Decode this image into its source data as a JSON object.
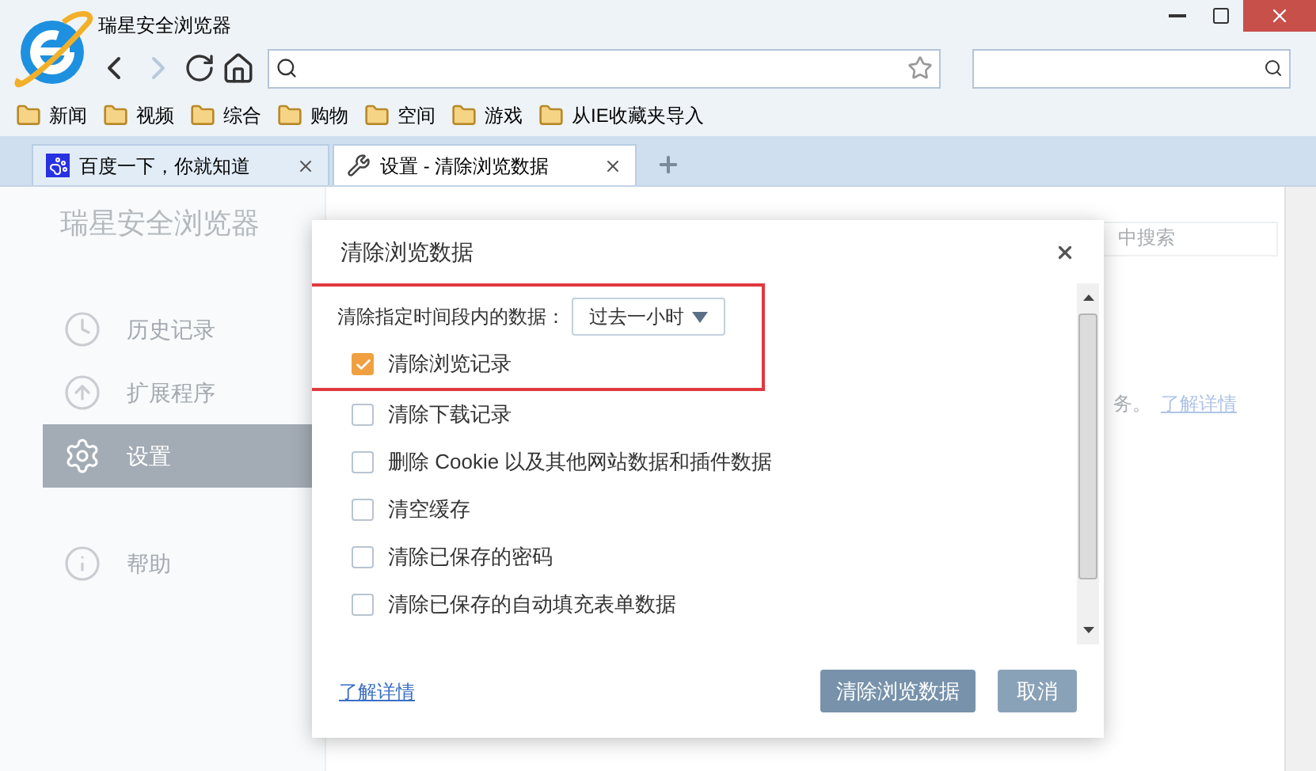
{
  "window": {
    "title": "瑞星安全浏览器"
  },
  "bookmarks": [
    {
      "label": "新闻"
    },
    {
      "label": "视频"
    },
    {
      "label": "综合"
    },
    {
      "label": "购物"
    },
    {
      "label": "空间"
    },
    {
      "label": "游戏"
    },
    {
      "label": "从IE收藏夹导入"
    }
  ],
  "tabs": [
    {
      "label": "百度一下，你就知道",
      "selected": false,
      "kind": "paw"
    },
    {
      "label": "设置 - 清除浏览数据",
      "selected": true,
      "kind": "wrench"
    }
  ],
  "sidebar": {
    "brand": "瑞星安全浏览器",
    "items": [
      {
        "label": "历史记录",
        "selected": false,
        "kind": "clock"
      },
      {
        "label": "扩展程序",
        "selected": false,
        "kind": "upload"
      },
      {
        "label": "设置",
        "selected": true,
        "kind": "gear"
      },
      {
        "label": "帮助",
        "selected": false,
        "kind": "info"
      }
    ]
  },
  "settings_page": {
    "search_placeholder": "中搜索",
    "text": "务。",
    "link": "了解详情"
  },
  "dialog": {
    "title": "清除浏览数据",
    "range_label": "清除指定时间段内的数据：",
    "range_value": "过去一小时",
    "options": [
      {
        "label": "清除浏览记录",
        "checked": true,
        "highlighted": true
      },
      {
        "label": "清除下载记录",
        "checked": false,
        "highlighted": false
      },
      {
        "label": "删除 Cookie 以及其他网站数据和插件数据",
        "checked": false,
        "highlighted": false
      },
      {
        "label": "清空缓存",
        "checked": false,
        "highlighted": false
      },
      {
        "label": "清除已保存的密码",
        "checked": false,
        "highlighted": false
      },
      {
        "label": "清除已保存的自动填充表单数据",
        "checked": false,
        "highlighted": false
      }
    ],
    "link": "了解详情",
    "buttons": [
      {
        "label": "清除浏览数据",
        "kind": "primary"
      },
      {
        "label": "取消",
        "kind": "secondary"
      }
    ]
  }
}
